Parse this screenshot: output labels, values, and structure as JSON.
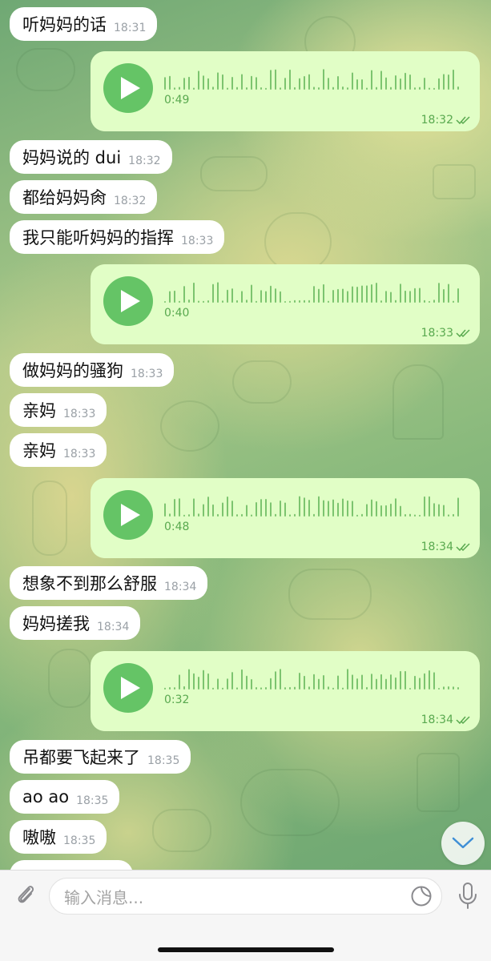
{
  "colors": {
    "incoming_bubble": "#ffffff",
    "outgoing_bubble": "#e1fec6",
    "accent_green": "#65c466",
    "outgoing_meta": "#59a94f",
    "incoming_time": "#9aa0a6"
  },
  "messages": [
    {
      "type": "text",
      "text": "听妈妈的话",
      "time": "18:31"
    },
    {
      "type": "voice",
      "duration": "0:49",
      "time": "18:32",
      "read": "double-check-icon"
    },
    {
      "type": "text",
      "text": "妈妈说的 dui",
      "time": "18:32"
    },
    {
      "type": "text",
      "text": "都给妈妈肏",
      "time": "18:32"
    },
    {
      "type": "text",
      "text": "我只能听妈妈的指挥",
      "time": "18:33"
    },
    {
      "type": "voice",
      "duration": "0:40",
      "time": "18:33",
      "read": "double-check-icon"
    },
    {
      "type": "text",
      "text": "做妈妈的骚狗",
      "time": "18:33"
    },
    {
      "type": "text",
      "text": "亲妈",
      "time": "18:33"
    },
    {
      "type": "text",
      "text": "亲妈",
      "time": "18:33"
    },
    {
      "type": "voice",
      "duration": "0:48",
      "time": "18:34",
      "read": "double-check-icon"
    },
    {
      "type": "text",
      "text": "想象不到那么舒服",
      "time": "18:34"
    },
    {
      "type": "text",
      "text": "妈妈搓我",
      "time": "18:34"
    },
    {
      "type": "voice",
      "duration": "0:32",
      "time": "18:34",
      "read": "double-check-icon"
    },
    {
      "type": "text",
      "text": "吊都要飞起来了",
      "time": "18:35"
    },
    {
      "type": "text",
      "text": "ao ao",
      "time": "18:35"
    },
    {
      "type": "text",
      "text": "嗷嗷",
      "time": "18:35"
    }
  ],
  "input": {
    "placeholder": "输入消息..."
  },
  "icons": {
    "attach": "paperclip-icon",
    "sticker": "sticker-icon",
    "mic": "microphone-icon",
    "scroll_down": "chevron-down-icon",
    "play": "play-icon"
  }
}
